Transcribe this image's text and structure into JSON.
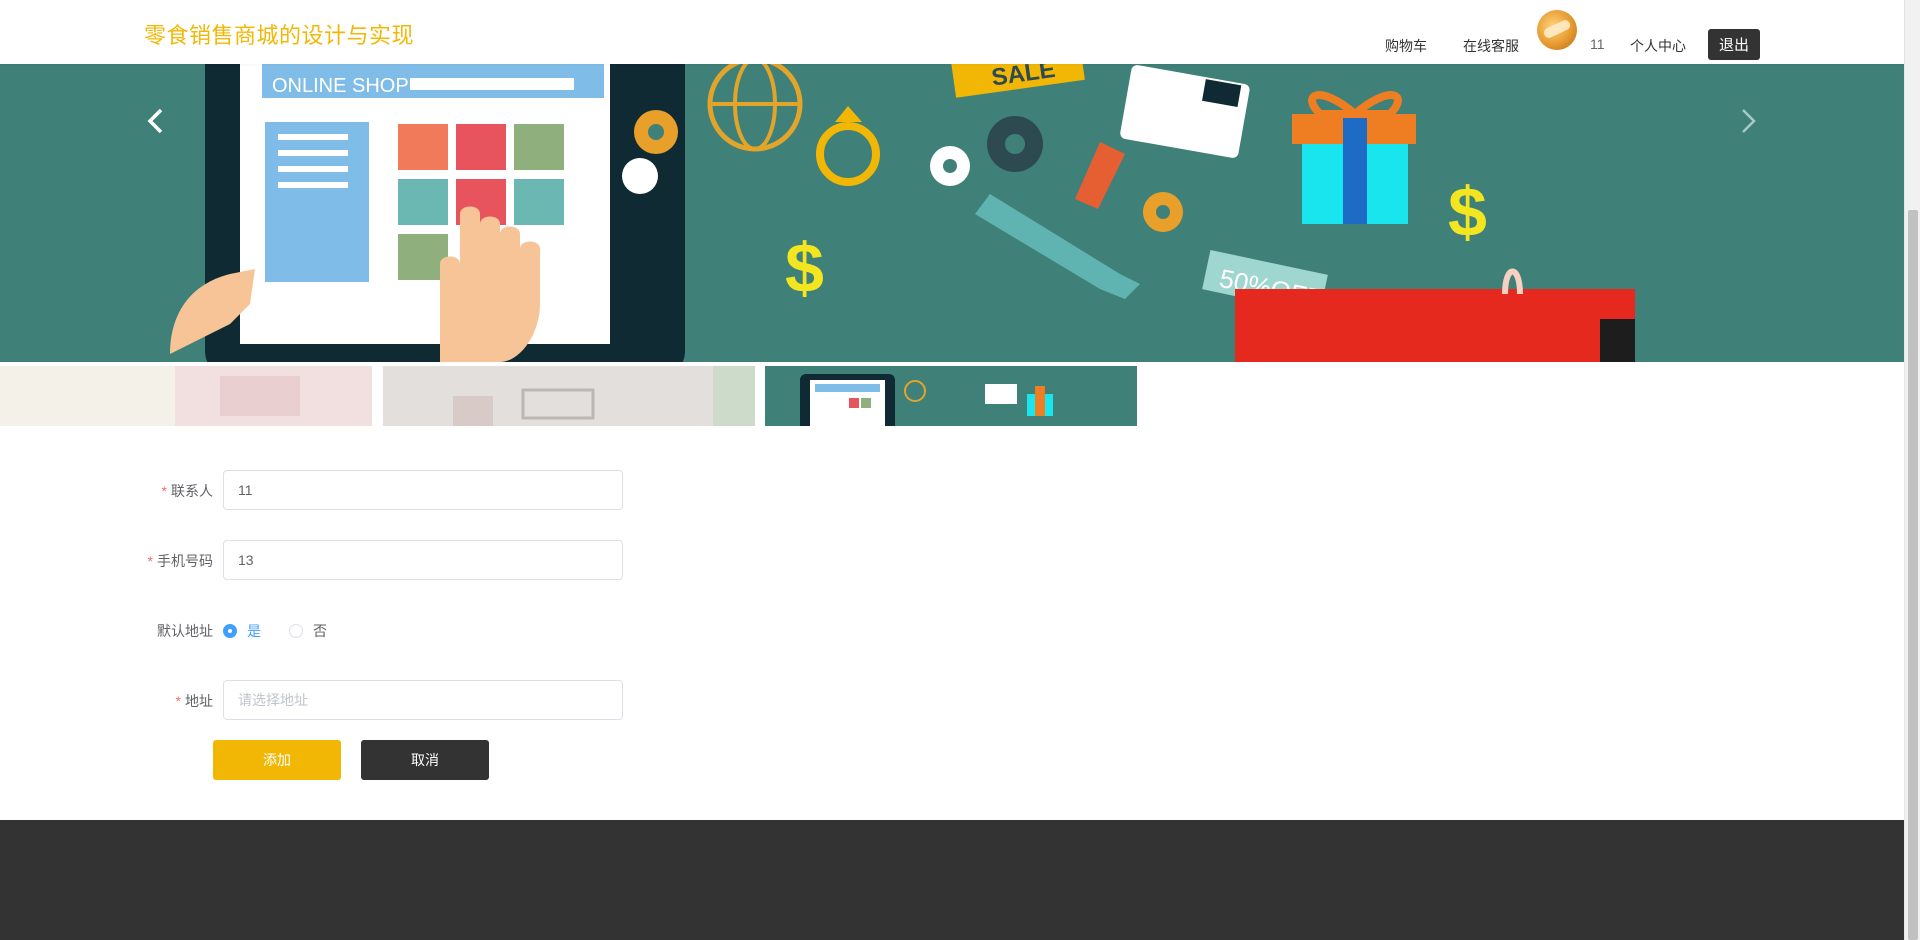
{
  "header": {
    "title": "零食销售商城的设计与实现",
    "nav": {
      "cart": "购物车",
      "service": "在线客服",
      "username": "11",
      "profile": "个人中心",
      "logout": "退出"
    }
  },
  "banner": {
    "text_online_shop": "ONLINE SHOP",
    "text_sale": "SALE",
    "text_off": "50%OFF",
    "text_dollar": "$"
  },
  "form": {
    "contact_label": "联系人",
    "contact_value": "11",
    "phone_label": "手机号码",
    "phone_value": "13",
    "default_label": "默认地址",
    "default_yes": "是",
    "default_no": "否",
    "address_label": "地址",
    "address_placeholder": "请选择地址",
    "add_button": "添加",
    "cancel_button": "取消"
  },
  "colors": {
    "brand": "#f2b705",
    "banner_bg": "#3f8078",
    "dark": "#333333",
    "radio_active": "#409eff"
  }
}
